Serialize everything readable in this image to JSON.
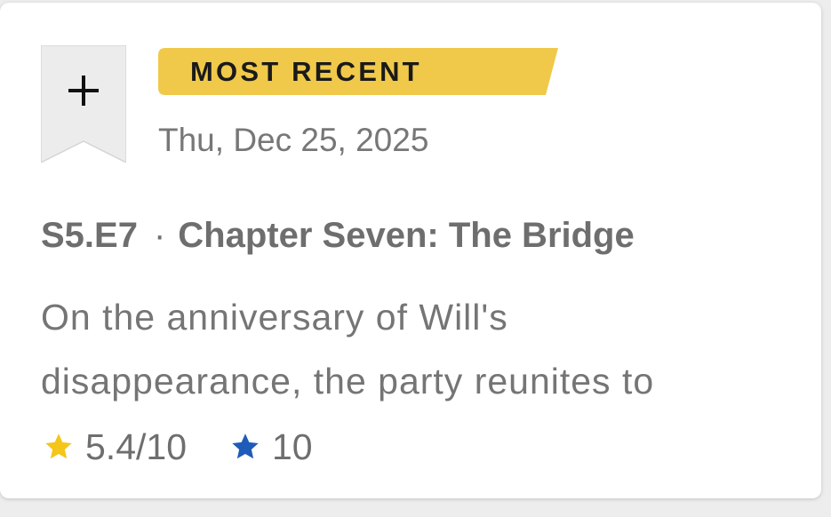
{
  "card": {
    "badge_label": "MOST RECENT",
    "air_date": "Thu, Dec 25, 2025",
    "episode_code": "S5.E7",
    "separator": "·",
    "episode_title": "Chapter Seven: The Bridge",
    "description_line1": "On the anniversary of Will's",
    "description_line2": "disappearance, the party reunites to",
    "rating": {
      "value": "5.4/10",
      "star_color": "#f5c518"
    },
    "user_rating": {
      "value": "10",
      "star_color": "#1f5bb8"
    },
    "icons": {
      "watchlist": "add-to-watchlist-ribbon-icon",
      "plus": "plus-icon",
      "rating_star": "star-icon",
      "user_rating_star": "star-icon"
    },
    "colors": {
      "badge_background": "#f0c94a",
      "ribbon_background": "#ececec"
    }
  }
}
